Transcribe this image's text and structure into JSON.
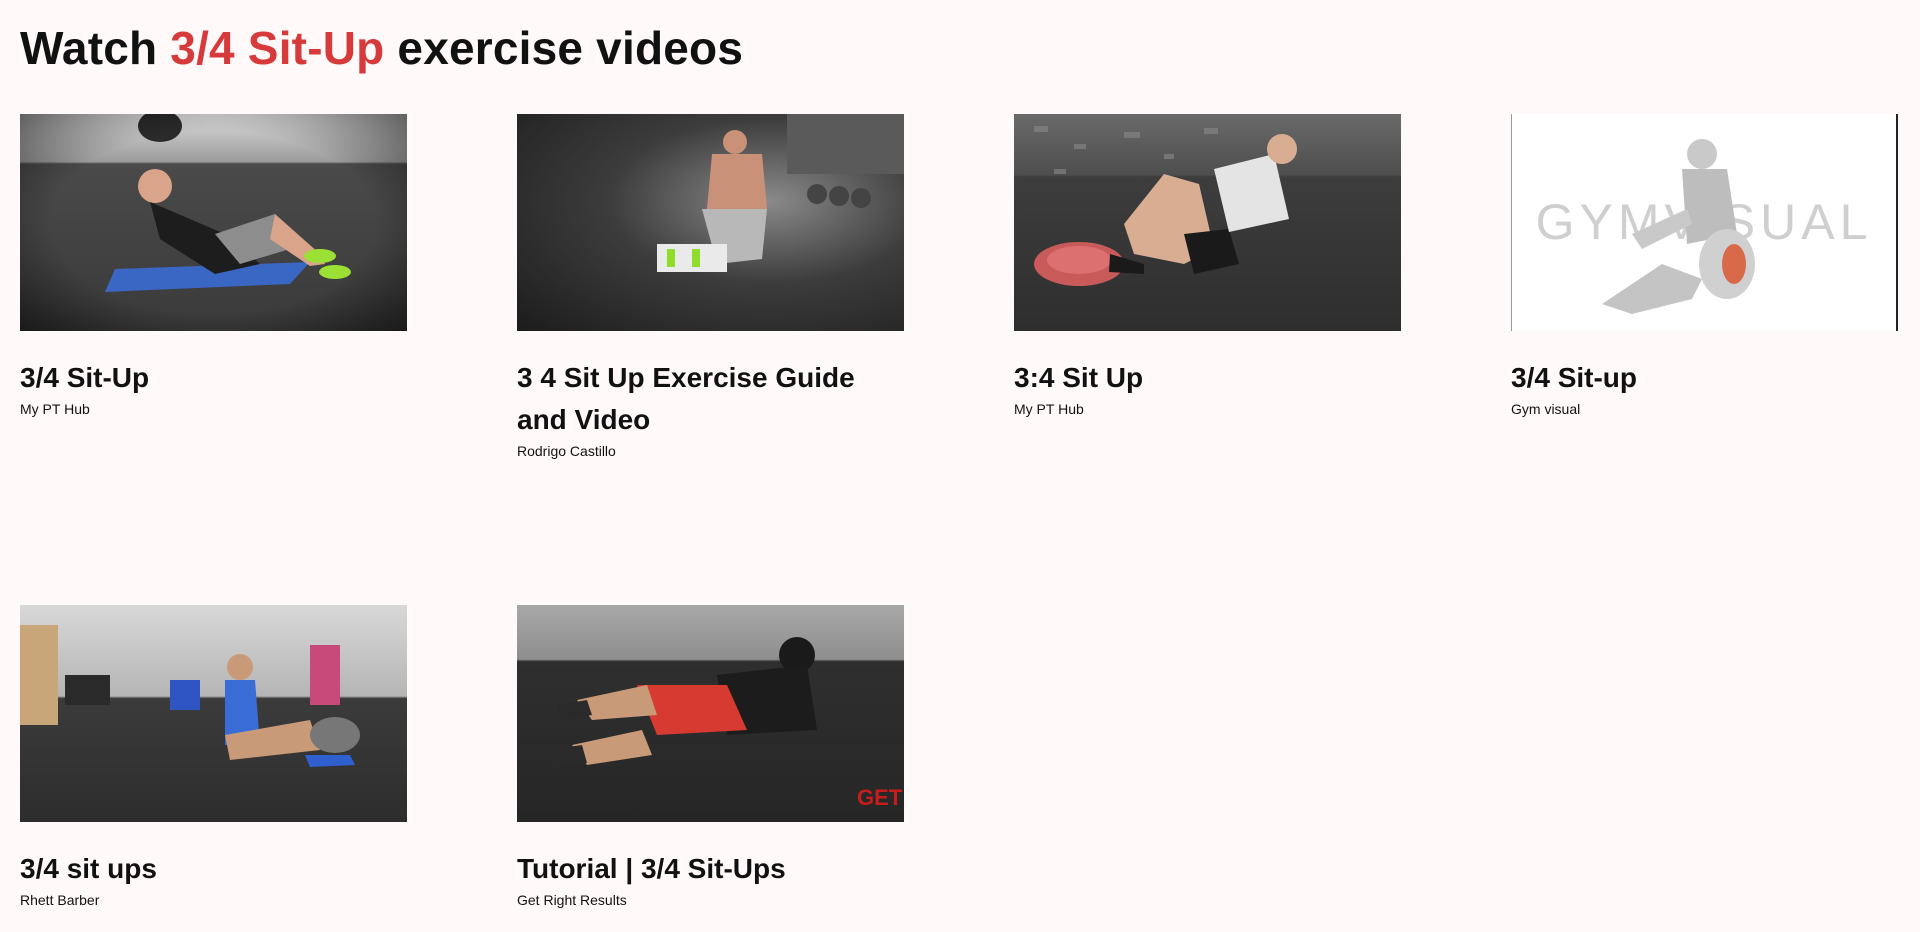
{
  "heading": {
    "prefix": "Watch ",
    "accent": "3/4 Sit-Up",
    "suffix": " exercise videos"
  },
  "colors": {
    "accent": "#d63a3a",
    "background": "#fff9f9",
    "text": "#111111"
  },
  "videos": [
    {
      "title": "3/4 Sit-Up",
      "author": "My PT Hub"
    },
    {
      "title": "3 4 Sit Up Exercise Guide and Video",
      "author": "Rodrigo Castillo"
    },
    {
      "title": "3:4 Sit Up",
      "author": "My PT Hub"
    },
    {
      "title": "3/4 Sit-up",
      "author": "Gym visual",
      "watermark": "GYMVISUAL"
    },
    {
      "title": "3/4 sit ups",
      "author": "Rhett Barber"
    },
    {
      "title": "Tutorial | 3/4 Sit-Ups",
      "author": "Get Right Results",
      "watermark": "GET R"
    }
  ]
}
